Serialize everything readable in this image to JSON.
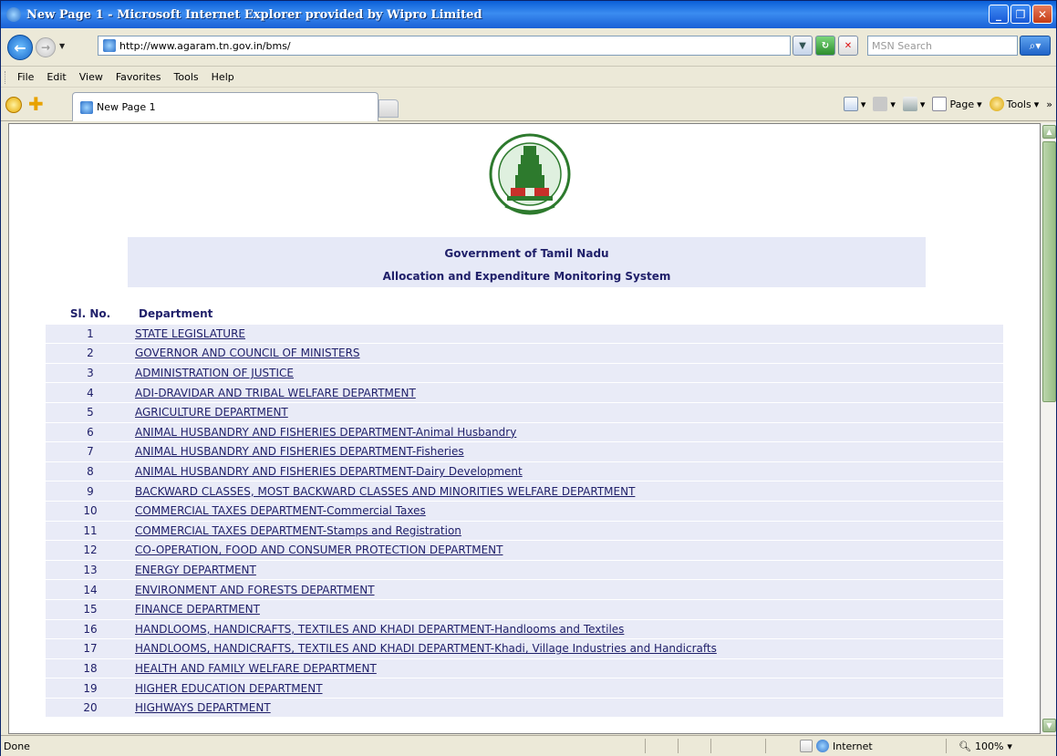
{
  "window": {
    "title": "New Page 1 - Microsoft Internet Explorer provided by Wipro Limited"
  },
  "address": {
    "url": "http://www.agaram.tn.gov.in/bms/"
  },
  "search": {
    "placeholder": "MSN Search"
  },
  "menu": [
    "File",
    "Edit",
    "View",
    "Favorites",
    "Tools",
    "Help"
  ],
  "tab": {
    "label": "New Page 1"
  },
  "commandbar": {
    "page": "Page",
    "tools": "Tools"
  },
  "status": {
    "text": "Done",
    "zone": "Internet",
    "zoom": "100%"
  },
  "page": {
    "line1": "Government of Tamil Nadu",
    "line2": "Allocation and Expenditure Monitoring System",
    "col_sl": "Sl. No.",
    "col_dept": "Department",
    "rows": [
      {
        "no": "1",
        "dept": "STATE LEGISLATURE"
      },
      {
        "no": "2",
        "dept": "GOVERNOR AND COUNCIL OF MINISTERS"
      },
      {
        "no": "3",
        "dept": "ADMINISTRATION OF JUSTICE"
      },
      {
        "no": "4",
        "dept": "ADI-DRAVIDAR AND TRIBAL WELFARE DEPARTMENT"
      },
      {
        "no": "5",
        "dept": "AGRICULTURE DEPARTMENT"
      },
      {
        "no": "6",
        "dept": "ANIMAL HUSBANDRY AND FISHERIES DEPARTMENT-Animal Husbandry"
      },
      {
        "no": "7",
        "dept": "ANIMAL HUSBANDRY AND FISHERIES DEPARTMENT-Fisheries"
      },
      {
        "no": "8",
        "dept": "ANIMAL HUSBANDRY AND FISHERIES DEPARTMENT-Dairy Development"
      },
      {
        "no": "9",
        "dept": "BACKWARD CLASSES, MOST BACKWARD CLASSES AND MINORITIES WELFARE DEPARTMENT"
      },
      {
        "no": "10",
        "dept": "COMMERCIAL TAXES DEPARTMENT-Commercial Taxes"
      },
      {
        "no": "11",
        "dept": "COMMERCIAL TAXES DEPARTMENT-Stamps and Registration"
      },
      {
        "no": "12",
        "dept": "CO-OPERATION, FOOD AND CONSUMER PROTECTION DEPARTMENT"
      },
      {
        "no": "13",
        "dept": "ENERGY DEPARTMENT"
      },
      {
        "no": "14",
        "dept": "ENVIRONMENT AND FORESTS DEPARTMENT"
      },
      {
        "no": "15",
        "dept": "FINANCE DEPARTMENT"
      },
      {
        "no": "16",
        "dept": "HANDLOOMS, HANDICRAFTS, TEXTILES AND KHADI DEPARTMENT-Handlooms and Textiles"
      },
      {
        "no": "17",
        "dept": "HANDLOOMS, HANDICRAFTS, TEXTILES AND KHADI DEPARTMENT-Khadi, Village Industries and Handicrafts"
      },
      {
        "no": "18",
        "dept": "HEALTH AND FAMILY WELFARE DEPARTMENT"
      },
      {
        "no": "19",
        "dept": "HIGHER EDUCATION DEPARTMENT"
      },
      {
        "no": "20",
        "dept": "HIGHWAYS DEPARTMENT"
      }
    ]
  }
}
